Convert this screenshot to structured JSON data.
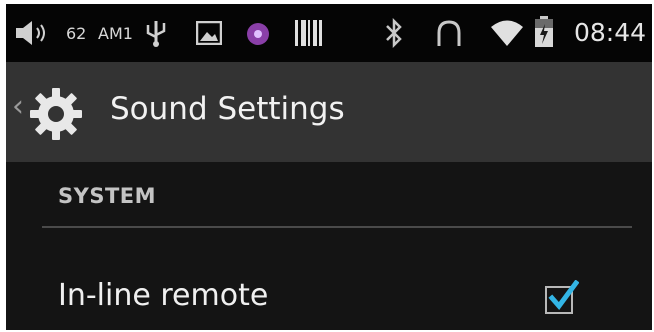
{
  "status_bar": {
    "level_text": "62",
    "am_text": "AM1",
    "time": "08:44",
    "icons": [
      "volume-icon",
      "usb-icon",
      "image-icon",
      "app-notification-icon",
      "barcode-icon",
      "bluetooth-icon",
      "headset-icon",
      "wifi-icon",
      "battery-icon"
    ]
  },
  "action_bar": {
    "title": "Sound Settings",
    "up_icon": "chevron-left-icon",
    "app_icon": "gear-icon"
  },
  "section": {
    "header": "SYSTEM"
  },
  "preferences": [
    {
      "label": "In-line remote",
      "checked": true
    }
  ],
  "colors": {
    "accent": "#33b5e5",
    "background": "#141414",
    "action_bar": "#333333"
  }
}
